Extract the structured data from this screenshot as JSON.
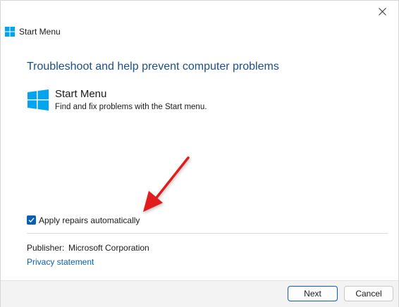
{
  "window": {
    "title": "Start Menu",
    "close_icon": "close-icon",
    "logo_icon": "windows-logo-icon"
  },
  "main": {
    "heading": "Troubleshoot and help prevent computer problems",
    "troubleshooter": {
      "icon": "windows-logo-icon",
      "title": "Start Menu",
      "description": "Find and fix problems with the Start menu."
    },
    "apply_repairs": {
      "label": "Apply repairs automatically",
      "checked": true
    },
    "publisher": {
      "label": "Publisher:",
      "value": "Microsoft Corporation"
    },
    "privacy_link": "Privacy statement"
  },
  "footer": {
    "next_label": "Next",
    "cancel_label": "Cancel"
  },
  "annotation": {
    "icon": "red-arrow-icon",
    "color": "#e01e1e"
  },
  "colors": {
    "accent": "#0a5fb4",
    "heading": "#1b4f8a",
    "windows_logo": "#00a4ef"
  }
}
